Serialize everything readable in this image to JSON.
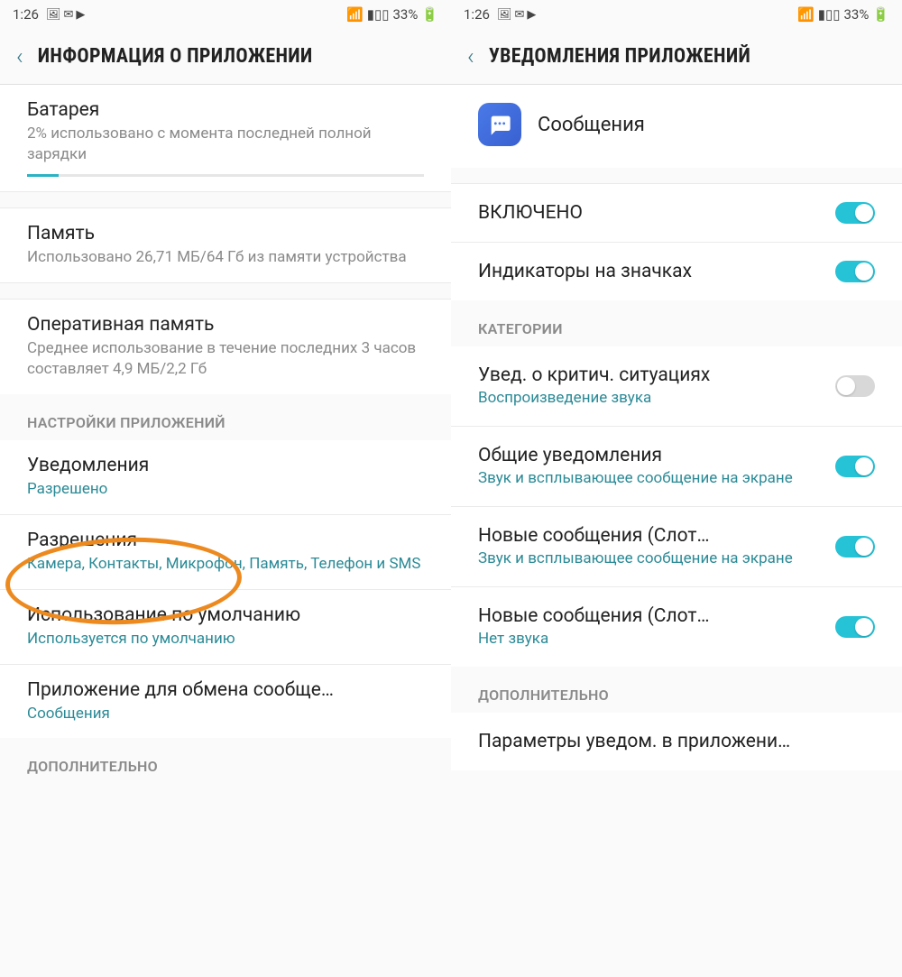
{
  "status": {
    "time": "1:26",
    "battery": "33%",
    "icons": [
      "🖼",
      "M",
      "▶"
    ]
  },
  "left": {
    "title": "ИНФОРМАЦИЯ О ПРИЛОЖЕНИИ",
    "battery": {
      "title": "Батарея",
      "sub": "2% использовано с момента последней полной зарядки"
    },
    "memory": {
      "title": "Память",
      "sub": "Использовано 26,71 МБ/64 Гб из памяти устройства"
    },
    "ram": {
      "title": "Оперативная память",
      "sub": "Среднее использование в течение последних 3 часов составляет 4,9 МБ/2,2 Гб"
    },
    "section1": "НАСТРОЙКИ ПРИЛОЖЕНИЙ",
    "notif": {
      "title": "Уведомления",
      "sub": "Разрешено"
    },
    "perms": {
      "title": "Разрешения",
      "sub": "Камера, Контакты, Микрофон, Память, Телефон и SMS"
    },
    "default": {
      "title": "Использование по умолчанию",
      "sub": "Используется по умолчанию"
    },
    "exchange": {
      "title": "Приложение для обмена сообще…",
      "sub": "Сообщения"
    },
    "section2": "ДОПОЛНИТЕЛЬНО"
  },
  "right": {
    "title": "УВЕДОМЛЕНИЯ ПРИЛОЖЕНИЙ",
    "app": "Сообщения",
    "enabled": "ВКЛЮЧЕНО",
    "badges": "Индикаторы на значках",
    "categories": "КАТЕГОРИИ",
    "rows": [
      {
        "title": "Увед. о критич. ситуациях",
        "sub": "Воспроизведение звука",
        "on": false
      },
      {
        "title": "Общие уведомления",
        "sub": "Звук и всплывающее сообщение на экране",
        "on": true
      },
      {
        "title": "Новые сообщения (Слот…",
        "sub": "Звук и всплывающее сообщение на экране",
        "on": true
      },
      {
        "title": "Новые сообщения (Слот…",
        "sub": "Нет звука",
        "on": true
      }
    ],
    "section2": "ДОПОЛНИТЕЛЬНО",
    "params": "Параметры уведом. в приложени…"
  }
}
